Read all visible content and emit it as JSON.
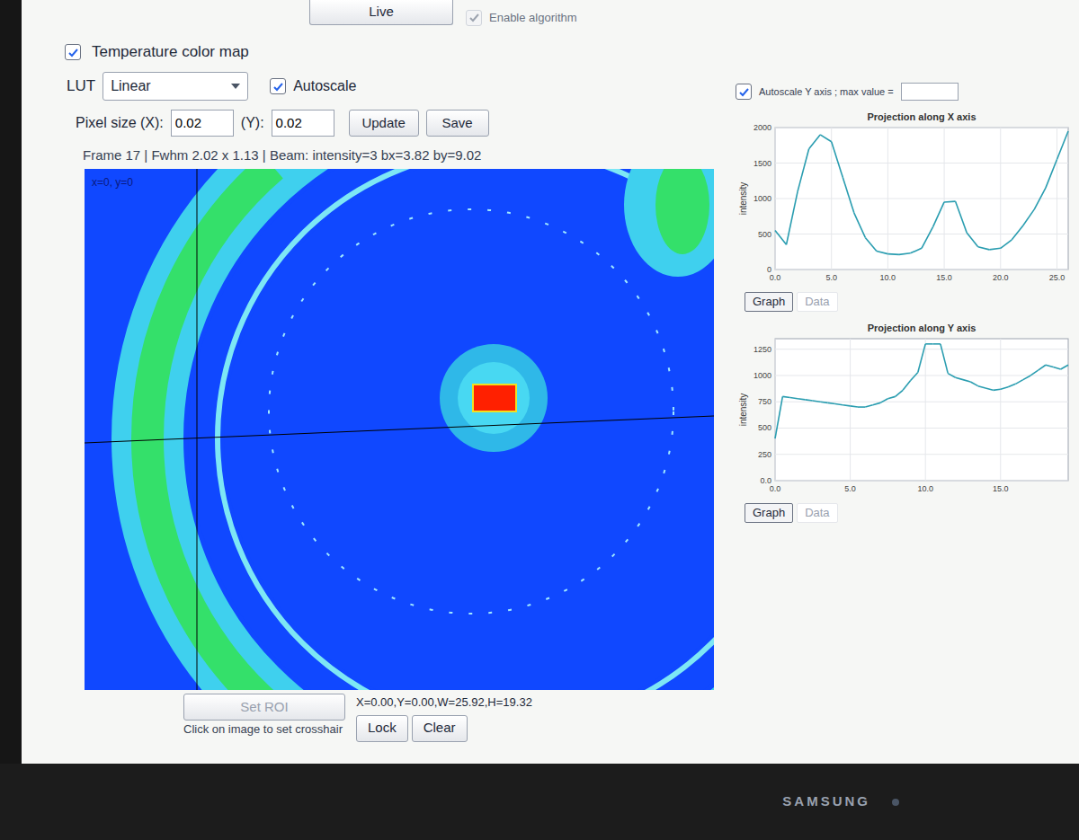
{
  "top_button": {
    "label": "Live"
  },
  "enable_algorithm": {
    "label": "Enable algorithm",
    "checked": true,
    "disabled": true
  },
  "temperature_color_map": {
    "label": "Temperature color map",
    "checked": true
  },
  "lut": {
    "label": "LUT",
    "value": "Linear"
  },
  "autoscale": {
    "label": "Autoscale",
    "checked": true
  },
  "pixel_size": {
    "label_x": "Pixel size (X):",
    "value_x": "0.02",
    "label_y": "(Y):",
    "value_y": "0.02"
  },
  "buttons": [
    "Update",
    "Save"
  ],
  "status": "Frame 17 | Fwhm 2.02 x 1.13 | Beam: intensity=3 bx=3.82 by=9.02",
  "image": {
    "cursor_label": "x=0, y=0"
  },
  "roi": {
    "button": "Set ROI",
    "disabled": true,
    "readout": "X=0.00,Y=0.00,W=25.92,H=19.32",
    "buttons": [
      "Lock",
      "Clear"
    ],
    "hint": "Click on image to set crosshair"
  },
  "y_autoscale": {
    "label": "Autoscale Y axis ; max value =",
    "checked": true,
    "value": ""
  },
  "charts": [
    {
      "title": "Projection along X axis",
      "y_label": "intensity",
      "y_ticks": [
        "0",
        "500",
        "1000",
        "1500",
        "2000"
      ],
      "x_ticks": [
        "0.0",
        "5.0",
        "10.0",
        "15.0",
        "20.0",
        "25.0"
      ],
      "x_step": 1,
      "x_max": 26,
      "y_max": 2000,
      "values": [
        550,
        350,
        1100,
        1700,
        1900,
        1800,
        1300,
        800,
        450,
        260,
        220,
        210,
        230,
        300,
        600,
        950,
        960,
        520,
        320,
        280,
        300,
        420,
        620,
        850,
        1150,
        1550,
        1950
      ],
      "tabs": [
        {
          "label": "Graph",
          "selected": true
        },
        {
          "label": "Data",
          "selected": false
        }
      ]
    },
    {
      "title": "Projection along Y axis",
      "y_label": "intensity",
      "y_ticks": [
        "0.0",
        "250",
        "500",
        "750",
        "1000",
        "1250"
      ],
      "x_ticks": [
        "0.0",
        "5.0",
        "10.0",
        "15.0"
      ],
      "x_step": 0.5,
      "x_max": 19.5,
      "y_max": 1350,
      "values": [
        400,
        800,
        790,
        780,
        770,
        760,
        750,
        740,
        730,
        720,
        710,
        700,
        700,
        720,
        740,
        780,
        800,
        860,
        950,
        1030,
        1300,
        1300,
        1300,
        1020,
        980,
        960,
        940,
        900,
        880,
        860,
        870,
        890,
        920,
        960,
        1000,
        1050,
        1100,
        1080,
        1060,
        1100
      ],
      "tabs": [
        {
          "label": "Graph",
          "selected": true
        },
        {
          "label": "Data",
          "selected": false
        }
      ]
    }
  ],
  "monitor": {
    "brand": "SAMSUNG"
  }
}
